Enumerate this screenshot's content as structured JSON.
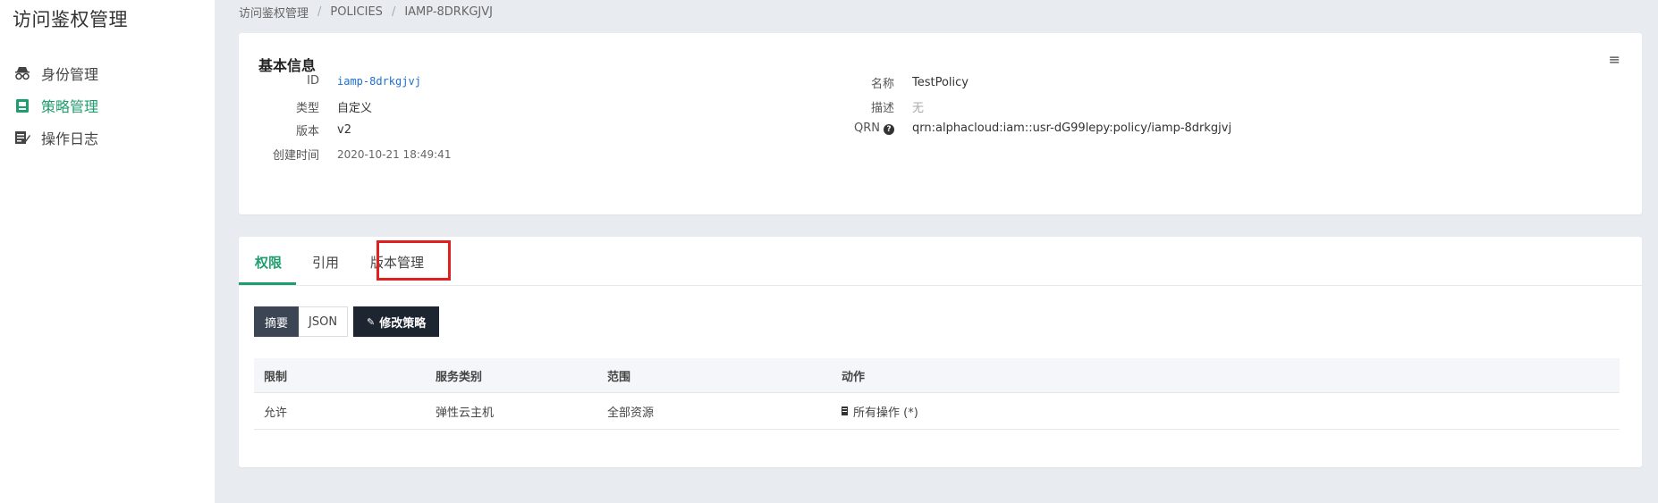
{
  "app": {
    "title": "访问鉴权管理"
  },
  "sidebar": {
    "items": [
      {
        "label": "身份管理",
        "icon": "identity-icon",
        "active": false
      },
      {
        "label": "策略管理",
        "icon": "policy-icon",
        "active": true
      },
      {
        "label": "操作日志",
        "icon": "log-icon",
        "active": false
      }
    ]
  },
  "breadcrumb": {
    "items": [
      "访问鉴权管理",
      "POLICIES",
      "IAMP-8DRKGJVJ"
    ],
    "separator": "/"
  },
  "info": {
    "title": "基本信息",
    "left": [
      {
        "label": "ID",
        "value": "iamp-8drkgjvj"
      },
      {
        "label": "类型",
        "value": "自定义"
      },
      {
        "label": "版本",
        "value": "v2"
      },
      {
        "label": "创建时间",
        "value": "2020-10-21 18:49:41"
      }
    ],
    "right": [
      {
        "label": "名称",
        "value": "TestPolicy"
      },
      {
        "label": "描述",
        "value": "无"
      },
      {
        "label": "QRN",
        "value": "qrn:alphacloud:iam::usr-dG99lepy:policy/iamp-8drkgjvj"
      }
    ]
  },
  "tabs": [
    {
      "label": "权限",
      "active": true
    },
    {
      "label": "引用",
      "active": false
    },
    {
      "label": "版本管理",
      "active": false,
      "highlighted": true
    }
  ],
  "view_toggle": {
    "options": [
      "摘要",
      "JSON"
    ],
    "selected": "摘要"
  },
  "edit_button": {
    "label": "修改策略"
  },
  "table": {
    "headers": [
      "限制",
      "服务类别",
      "范围",
      "动作"
    ],
    "rows": [
      {
        "effect": "允许",
        "service": "弹性云主机",
        "scope": "全部资源",
        "action": "所有操作 (*)"
      }
    ]
  },
  "colors": {
    "accent": "#1f9d6e",
    "highlight": "#e02020",
    "link": "#1d6fd1",
    "dark_button": "#1d2530"
  }
}
